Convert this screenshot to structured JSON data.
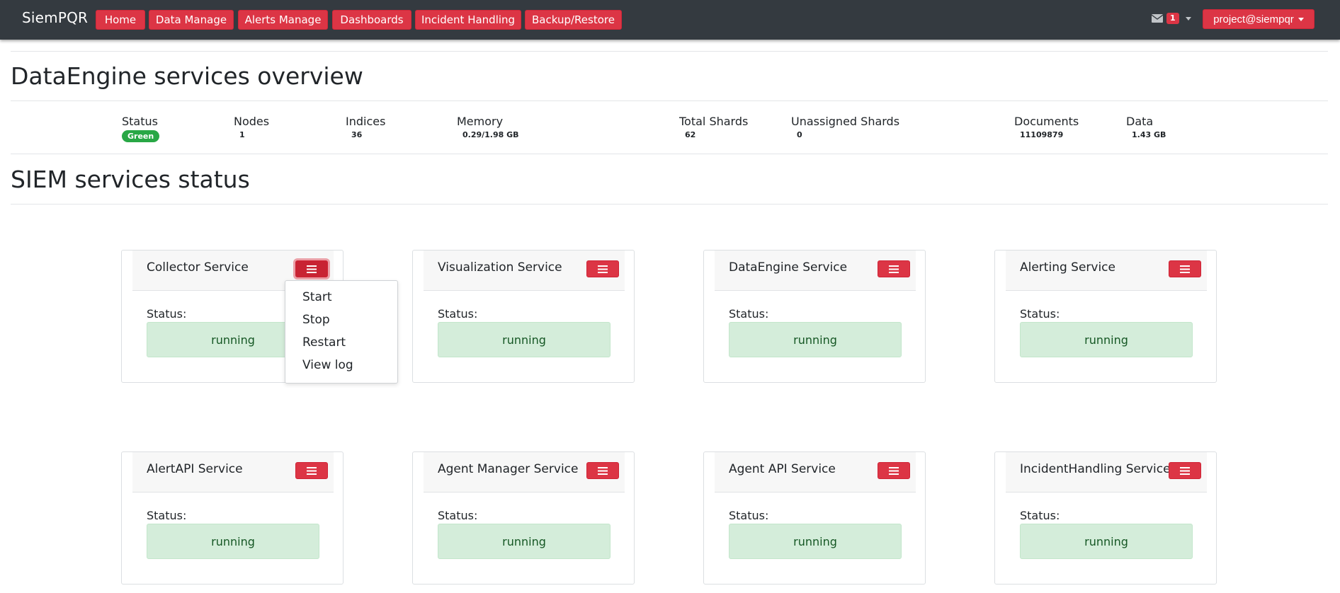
{
  "navbar": {
    "brand": "SiemPQR",
    "items": [
      "Home",
      "Data Manage",
      "Alerts Manage",
      "Dashboards",
      "Incident Handling",
      "Backup/Restore"
    ],
    "mail_count": "1",
    "user": "project@siempqr"
  },
  "dataengine": {
    "title": "DataEngine services overview",
    "stats": [
      {
        "label": "Status",
        "value": "Green"
      },
      {
        "label": "Nodes",
        "value": "1"
      },
      {
        "label": "Indices",
        "value": "36"
      },
      {
        "label": "Memory",
        "value": "0.29/1.98 GB"
      },
      {
        "label": "Total Shards",
        "value": "62"
      },
      {
        "label": "Unassigned Shards",
        "value": "0"
      },
      {
        "label": "Documents",
        "value": "11109879"
      },
      {
        "label": "Data",
        "value": "1.43 GB"
      }
    ]
  },
  "siem": {
    "title": "SIEM services status",
    "status_label": "Status:",
    "services": [
      {
        "name": "Collector Service",
        "status": "running"
      },
      {
        "name": "Visualization Service",
        "status": "running"
      },
      {
        "name": "DataEngine Service",
        "status": "running"
      },
      {
        "name": "Alerting Service",
        "status": "running"
      },
      {
        "name": "AlertAPI Service",
        "status": "running"
      },
      {
        "name": "Agent Manager Service",
        "status": "running"
      },
      {
        "name": "Agent API Service",
        "status": "running"
      },
      {
        "name": "IncidentHandling Service",
        "status": "running"
      }
    ]
  },
  "dropdown": {
    "items": [
      "Start",
      "Stop",
      "Restart",
      "View log"
    ]
  },
  "colors": {
    "navbar": "#343a40",
    "accent": "#dc3545",
    "running_bg": "#d4edda",
    "running_text": "#155724",
    "status_green": "#28a745"
  }
}
